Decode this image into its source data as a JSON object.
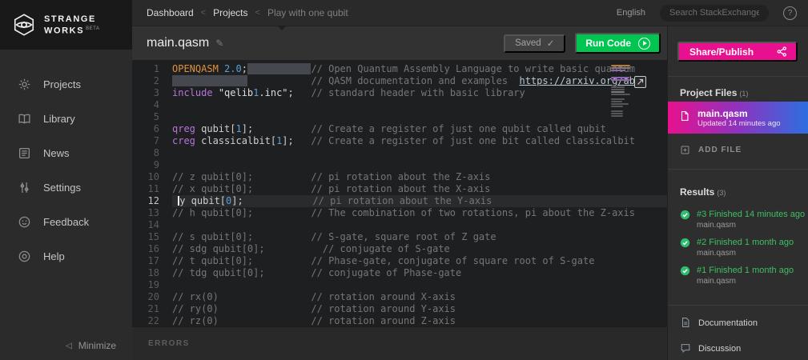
{
  "brand": {
    "line1": "STRANGE",
    "line2": "WORKS",
    "beta": "BETA"
  },
  "topbar": {
    "breadcrumb": [
      {
        "label": "Dashboard",
        "current": false
      },
      {
        "label": "Projects",
        "current": false
      },
      {
        "label": "Play with one qubit",
        "current": true
      }
    ],
    "separator": "<",
    "language": "English",
    "search_placeholder": "Search StackExchange",
    "help_glyph": "?"
  },
  "sidebar": {
    "items": [
      {
        "label": "Projects",
        "icon": "gear-icon"
      },
      {
        "label": "Library",
        "icon": "book-icon"
      },
      {
        "label": "News",
        "icon": "news-icon"
      },
      {
        "label": "Settings",
        "icon": "sliders-icon"
      },
      {
        "label": "Feedback",
        "icon": "smiley-icon"
      },
      {
        "label": "Help",
        "icon": "lifebuoy-icon"
      }
    ],
    "minimize_label": "Minimize",
    "minimize_chevron": "◁"
  },
  "editor": {
    "filename": "main.qasm",
    "pencil_glyph": "✎",
    "saved_label": "Saved",
    "saved_check": "✓",
    "run_label": "Run Code",
    "errors_label": "ERRORS",
    "lines": [
      {
        "n": 1,
        "tokens": [
          [
            "o",
            "OPENQASM"
          ],
          [
            "p",
            " "
          ],
          [
            "n",
            "2.0"
          ],
          [
            "p",
            ";"
          ],
          [
            "sel",
            "           "
          ],
          [
            "c",
            "// Open Quantum Assembly Language to write basic quantum"
          ]
        ]
      },
      {
        "n": 2,
        "tokens": [
          [
            "sel",
            "             "
          ],
          [
            "p",
            "           "
          ],
          [
            "c",
            "// QASM documentation and examples  "
          ],
          [
            "u",
            "https://arxiv.org/ab"
          ]
        ]
      },
      {
        "n": 3,
        "tokens": [
          [
            "k",
            "include"
          ],
          [
            "p",
            " "
          ],
          [
            "s",
            "\"qelib"
          ],
          [
            "n",
            "1"
          ],
          [
            "s",
            ".inc\""
          ],
          [
            "p",
            ";   "
          ],
          [
            "c",
            "// standard header with basic library"
          ]
        ]
      },
      {
        "n": 4,
        "tokens": []
      },
      {
        "n": 5,
        "tokens": []
      },
      {
        "n": 6,
        "tokens": [
          [
            "k",
            "qreg"
          ],
          [
            "p",
            " qubit["
          ],
          [
            "n",
            "1"
          ],
          [
            "p",
            "];          "
          ],
          [
            "c",
            "// Create a register of just one qubit called qubit"
          ]
        ]
      },
      {
        "n": 7,
        "tokens": [
          [
            "k",
            "creg"
          ],
          [
            "p",
            " classicalbit["
          ],
          [
            "n",
            "1"
          ],
          [
            "p",
            "];   "
          ],
          [
            "c",
            "// Create a register of just one bit called classicalbit"
          ]
        ]
      },
      {
        "n": 8,
        "tokens": []
      },
      {
        "n": 9,
        "tokens": []
      },
      {
        "n": 10,
        "tokens": [
          [
            "c",
            "// z qubit[0];"
          ],
          [
            "p",
            "          "
          ],
          [
            "c",
            "// pi rotation about the Z-axis"
          ]
        ]
      },
      {
        "n": 11,
        "tokens": [
          [
            "c",
            "// x qubit[0];"
          ],
          [
            "p",
            "          "
          ],
          [
            "c",
            "// pi rotation about the X-axis"
          ]
        ]
      },
      {
        "n": 12,
        "active": true,
        "tokens": [
          [
            "p",
            " "
          ],
          [
            "caret",
            ""
          ],
          [
            "p",
            "y qubit["
          ],
          [
            "n",
            "0"
          ],
          [
            "p",
            "];            "
          ],
          [
            "c",
            "// pi rotation about the Y-axis"
          ]
        ]
      },
      {
        "n": 13,
        "tokens": [
          [
            "c",
            "// h qubit[0];"
          ],
          [
            "p",
            "          "
          ],
          [
            "c",
            "// The combination of two rotations, pi about the Z-axis"
          ]
        ]
      },
      {
        "n": 14,
        "tokens": []
      },
      {
        "n": 15,
        "tokens": [
          [
            "c",
            "// s qubit[0];"
          ],
          [
            "p",
            "          "
          ],
          [
            "c",
            "// S-gate, square root of Z gate"
          ]
        ]
      },
      {
        "n": 16,
        "tokens": [
          [
            "c",
            "// sdg qubit[0];"
          ],
          [
            "p",
            "          "
          ],
          [
            "c",
            "// conjugate of S-gate"
          ]
        ]
      },
      {
        "n": 17,
        "tokens": [
          [
            "c",
            "// t qubit[0];"
          ],
          [
            "p",
            "          "
          ],
          [
            "c",
            "// Phase-gate, conjugate of square root of S-gate"
          ]
        ]
      },
      {
        "n": 18,
        "tokens": [
          [
            "c",
            "// tdg qubit[0];"
          ],
          [
            "p",
            "        "
          ],
          [
            "c",
            "// conjugate of Phase-gate"
          ]
        ]
      },
      {
        "n": 19,
        "tokens": []
      },
      {
        "n": 20,
        "tokens": [
          [
            "c",
            "// rx(0)"
          ],
          [
            "p",
            "                "
          ],
          [
            "c",
            "// rotation around X-axis"
          ]
        ]
      },
      {
        "n": 21,
        "tokens": [
          [
            "c",
            "// ry(0)"
          ],
          [
            "p",
            "                "
          ],
          [
            "c",
            "// rotation around Y-axis"
          ]
        ]
      },
      {
        "n": 22,
        "tokens": [
          [
            "c",
            "// rz(0)"
          ],
          [
            "p",
            "                "
          ],
          [
            "c",
            "// rotation around Z-axis"
          ]
        ]
      }
    ]
  },
  "right_panel": {
    "share_label": "Share/Publish",
    "project_files": {
      "title": "Project Files",
      "count": "(1)",
      "files": [
        {
          "name": "main.qasm",
          "updated": "Updated 14 minutes ago"
        }
      ],
      "add_file_label": "ADD FILE"
    },
    "results": {
      "title": "Results",
      "count": "(3)",
      "items": [
        {
          "title": "#3 Finished 14 minutes ago",
          "file": "main.qasm"
        },
        {
          "title": "#2 Finished 1 month ago",
          "file": "main.qasm"
        },
        {
          "title": "#1 Finished 1 month ago",
          "file": "main.qasm"
        }
      ]
    },
    "links": [
      {
        "label": "Documentation",
        "icon": "document-icon"
      },
      {
        "label": "Discussion",
        "icon": "chat-icon"
      }
    ]
  },
  "colors": {
    "accent_pink": "#e8108e",
    "run_green": "#00c551",
    "result_green": "#3ebf63",
    "gradient_blue": "#2d6fe0"
  }
}
